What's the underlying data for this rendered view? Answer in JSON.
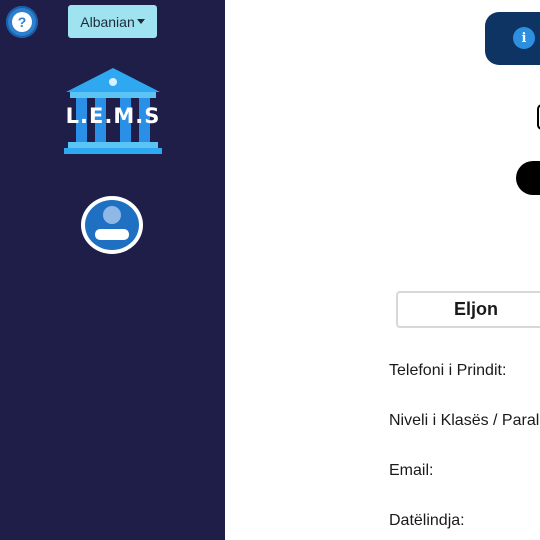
{
  "sidebar": {
    "help_icon": "question-circle",
    "help_glyph": "?",
    "language_label": "Albanian",
    "logo_text": "L.E.M.S",
    "avatar_icon": "user-avatar"
  },
  "header": {
    "info_icon": "info-circle",
    "info_glyph": "i"
  },
  "profile": {
    "name": "Eljon",
    "fields": [
      {
        "label": "Telefoni i Prindit:"
      },
      {
        "label": "Niveli i Klasës / Paralelja"
      },
      {
        "label": "Email:"
      },
      {
        "label": "Datëlindja:"
      }
    ]
  },
  "colors": {
    "sidebar_bg": "#1e1e48",
    "accent": "#2d7fd0",
    "language_bg": "#9fe3f0",
    "info_pill_bg": "#0e3463"
  }
}
